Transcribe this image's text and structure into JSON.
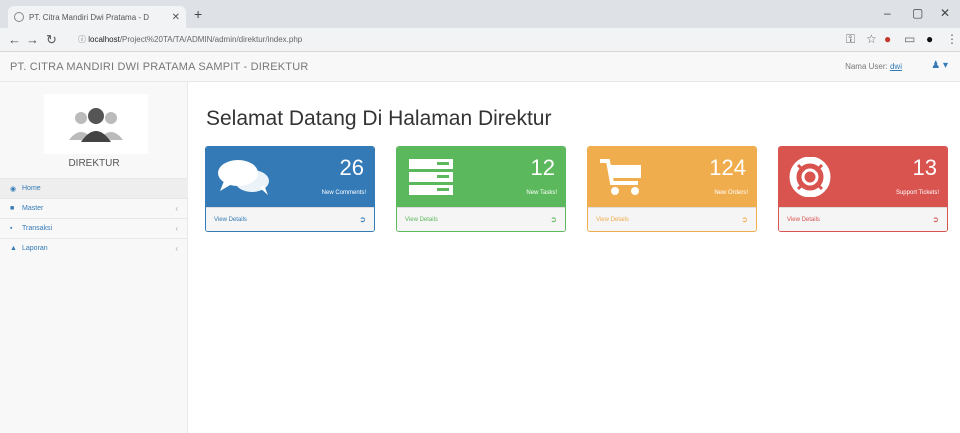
{
  "browser": {
    "tab_title": "PT. Citra Mandiri Dwi Pratama - D",
    "url_host": "localhost",
    "url_path": "/Project%20TA/TA/ADMIN/admin/direktur/index.php"
  },
  "header": {
    "brand": "PT. CITRA MANDIRI DWI PRATAMA SAMPIT - DIREKTUR",
    "user_label": "Nama User:",
    "user_name": "dwi"
  },
  "sidebar": {
    "role": "DIREKTUR",
    "items": [
      {
        "label": "Home",
        "icon": "dashboard-icon"
      },
      {
        "label": "Master",
        "icon": "folder-icon"
      },
      {
        "label": "Transaksi",
        "icon": "file-icon"
      },
      {
        "label": "Laporan",
        "icon": "chart-icon"
      }
    ]
  },
  "main": {
    "title": "Selamat Datang Di Halaman Direktur",
    "panels": [
      {
        "count": "26",
        "caption": "New Comments!",
        "footer": "View Details",
        "color": "#337ab7",
        "icon": "comments-icon"
      },
      {
        "count": "12",
        "caption": "New Tasks!",
        "footer": "View Details",
        "color": "#5cb85c",
        "icon": "tasks-icon"
      },
      {
        "count": "124",
        "caption": "New Orders!",
        "footer": "View Details",
        "color": "#f0ad4e",
        "icon": "shopping-cart-icon"
      },
      {
        "count": "13",
        "caption": "Support Tickets!",
        "footer": "View Details",
        "color": "#d9534f",
        "icon": "support-icon"
      }
    ]
  }
}
